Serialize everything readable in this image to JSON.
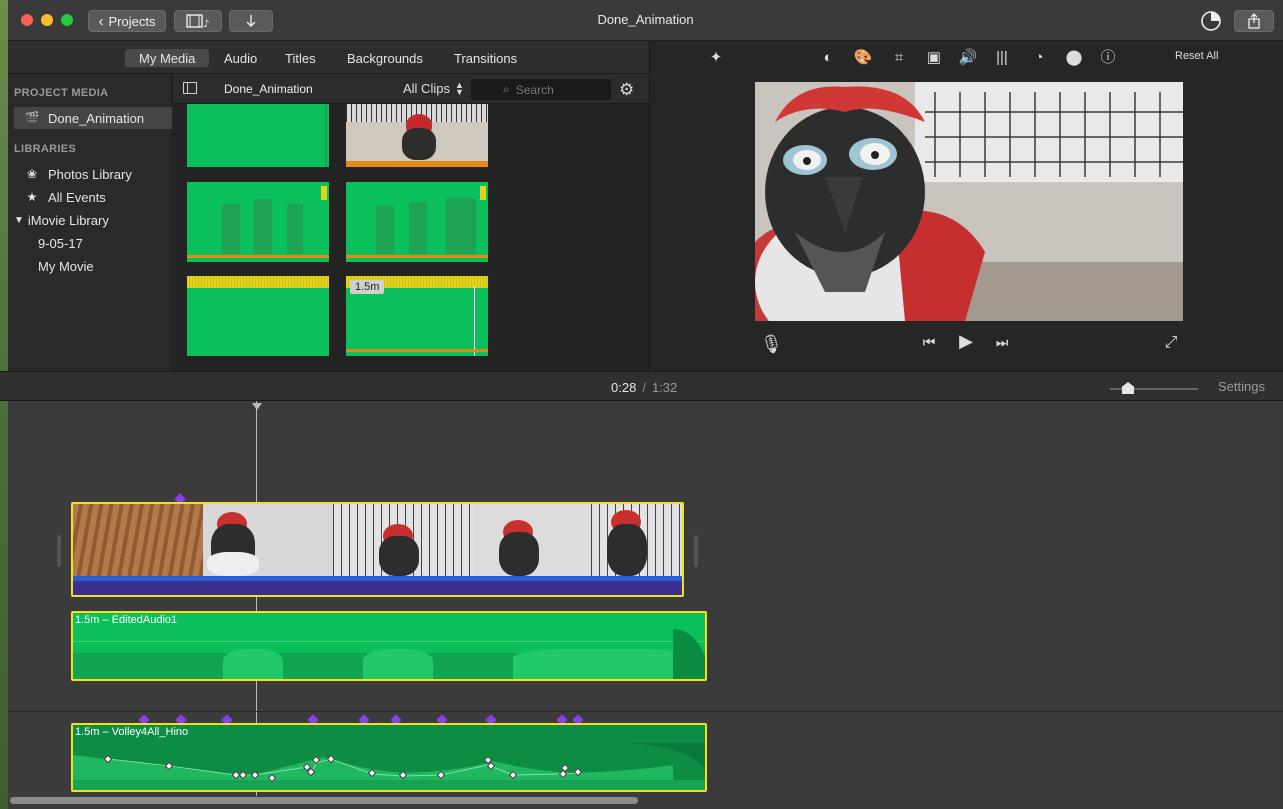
{
  "window": {
    "title": "Done_Animation"
  },
  "titlebar": {
    "projects_label": "Projects",
    "back_glyph": "‹"
  },
  "media_tabs": [
    {
      "label": "My Media",
      "active": true
    },
    {
      "label": "Audio"
    },
    {
      "label": "Titles"
    },
    {
      "label": "Backgrounds"
    },
    {
      "label": "Transitions"
    }
  ],
  "sidebar": {
    "project_media_heading": "PROJECT MEDIA",
    "project_item": "Done_Animation",
    "libraries_heading": "LIBRARIES",
    "photos_library": "Photos Library",
    "all_events": "All Events",
    "imovie_library": "iMovie Library",
    "event_1": "9-05-17",
    "event_2": "My Movie"
  },
  "clip_header": {
    "title": "Done_Animation",
    "filter_label": "All Clips",
    "search_placeholder": "Search"
  },
  "clip_thumbs": {
    "duration_badge": "1.5m"
  },
  "viewer": {
    "reset_label": "Reset All"
  },
  "timeline": {
    "current_time": "0:28",
    "separator": "/",
    "total_time": "1:32",
    "settings_label": "Settings",
    "audio_clip_1": "1.5m – EditedAudio1",
    "audio_clip_2": "1.5m – Volley4All_Hino"
  },
  "colors": {
    "accent_yellow": "#f1e21b",
    "audio_green": "#0bbf5a",
    "marker_purple": "#8a3ff0",
    "volume_orange": "#ef8a1a"
  }
}
